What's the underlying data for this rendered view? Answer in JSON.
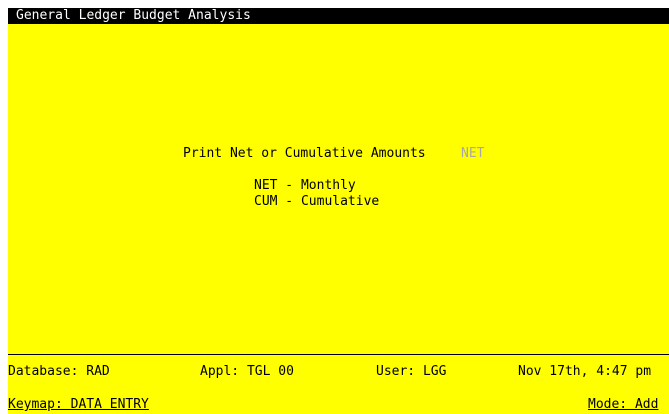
{
  "window": {
    "title": "General Ledger Budget Analysis"
  },
  "form": {
    "prompt_label": "Print Net or Cumulative Amounts",
    "prompt_value": "NET",
    "options": [
      "NET - Monthly",
      "CUM - Cumulative"
    ]
  },
  "status": {
    "database": "Database: RAD",
    "appl": "Appl: TGL 00",
    "user": "User: LGG",
    "datetime": "Nov 17th, 4:47 pm",
    "keymap": "Keymap: DATA ENTRY",
    "mode": "Mode: Add"
  },
  "colors": {
    "background": "#ffff00",
    "titlebar": "#000000",
    "text": "#000000",
    "input_value": "#a8a8a8"
  }
}
